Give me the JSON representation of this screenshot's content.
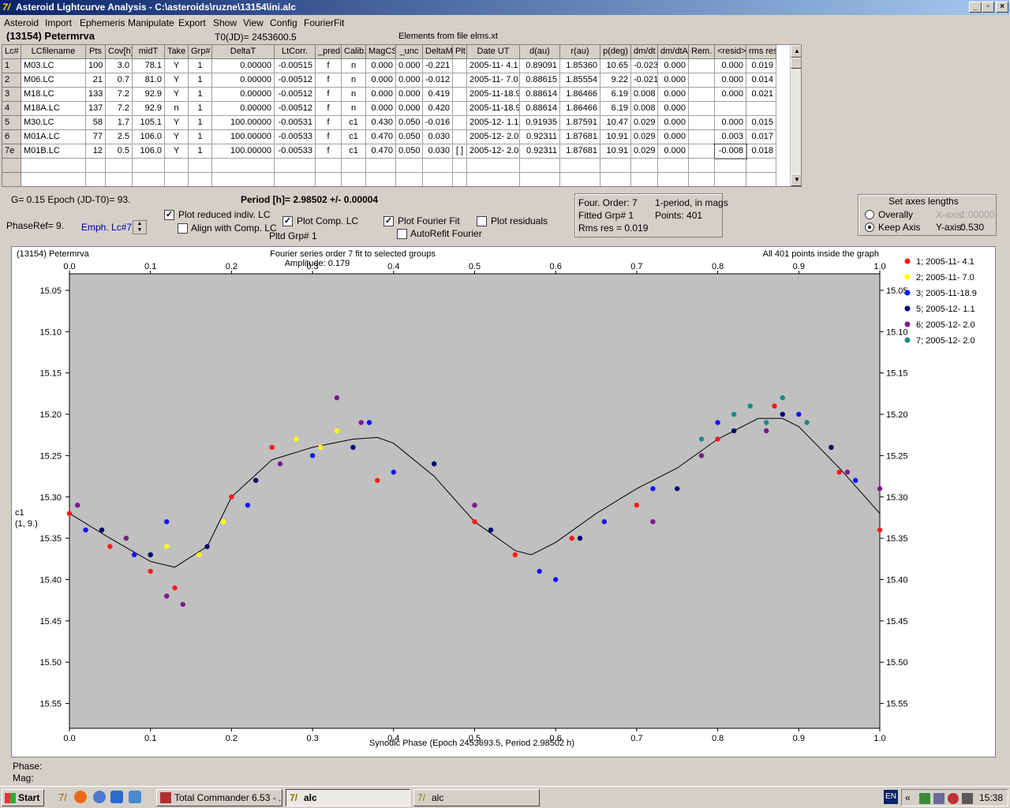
{
  "window": {
    "title": "Asteroid Lightcurve Analysis - C:\\asteroids\\ruzne\\13154\\ini.alc"
  },
  "menu": [
    "Asteroid",
    "Import",
    "Ephemeris",
    "Manipulate",
    "Export",
    "Show",
    "View",
    "Config",
    "FourierFit"
  ],
  "header": {
    "object": "(13154) Petermrva",
    "t0": "T0(JD)= 2453600.5",
    "elements": "Elements from file elms.xt"
  },
  "table": {
    "columns": [
      "Lc#",
      "LCfilename",
      "Pts",
      "Cov[h]",
      "midT",
      "Take",
      "Grp#",
      "DeltaT",
      "LtCorr.",
      "_pred.",
      "Calib.",
      "MagCS",
      "_unc",
      "DeltaM",
      "Plt",
      "Date UT",
      "d(au)",
      "r(au)",
      "p(deg)",
      "dm/dt",
      "dm/dtA",
      "Rem.",
      "<resid>",
      "rms res"
    ],
    "rows": [
      [
        "1",
        "M03.LC",
        "100",
        "3.0",
        "78.1",
        "Y",
        "1",
        "0.00000",
        "-0.00515",
        "f",
        "n",
        "0.000",
        "0.000",
        "-0.221",
        "",
        "2005-11- 4.1",
        "0.89091",
        "1.85360",
        "10.65",
        "-0.023",
        "0.000",
        "",
        "0.000",
        "0.019"
      ],
      [
        "2",
        "M06.LC",
        "21",
        "0.7",
        "81.0",
        "Y",
        "1",
        "0.00000",
        "-0.00512",
        "f",
        "n",
        "0.000",
        "0.000",
        "-0.012",
        "",
        "2005-11- 7.0",
        "0.88615",
        "1.85554",
        "9.22",
        "-0.021",
        "0.000",
        "",
        "0.000",
        "0.014"
      ],
      [
        "3",
        "M18.LC",
        "133",
        "7.2",
        "92.9",
        "Y",
        "1",
        "0.00000",
        "-0.00512",
        "f",
        "n",
        "0.000",
        "0.000",
        "0.419",
        "",
        "2005-11-18.9",
        "0.88614",
        "1.86466",
        "6.19",
        "0.008",
        "0.000",
        "",
        "0.000",
        "0.021"
      ],
      [
        "4",
        "M18A.LC",
        "137",
        "7.2",
        "92.9",
        "n",
        "1",
        "0.00000",
        "-0.00512",
        "f",
        "n",
        "0.000",
        "0.000",
        "0.420",
        "",
        "2005-11-18.9",
        "0.88614",
        "1.86466",
        "6.19",
        "0.008",
        "0.000",
        "",
        "",
        ""
      ],
      [
        "5",
        "M30.LC",
        "58",
        "1.7",
        "105.1",
        "Y",
        "1",
        "100.00000",
        "-0.00531",
        "f",
        "c1",
        "0.430",
        "0.050",
        "-0.016",
        "",
        "2005-12- 1.1",
        "0.91935",
        "1.87591",
        "10.47",
        "0.029",
        "0.000",
        "",
        "0.000",
        "0.015"
      ],
      [
        "6",
        "M01A.LC",
        "77",
        "2.5",
        "106.0",
        "Y",
        "1",
        "100.00000",
        "-0.00533",
        "f",
        "c1",
        "0.470",
        "0.050",
        "0.030",
        "",
        "2005-12- 2.0",
        "0.92311",
        "1.87681",
        "10.91",
        "0.029",
        "0.000",
        "",
        "0.003",
        "0.017"
      ],
      [
        "7e",
        "M01B.LC",
        "12",
        "0.5",
        "106.0",
        "Y",
        "1",
        "100.00000",
        "-0.00533",
        "f",
        "c1",
        "0.470",
        "0.050",
        "0.030",
        "[ ]",
        "2005-12- 2.0",
        "0.92311",
        "1.87681",
        "10.91",
        "0.029",
        "0.000",
        "",
        "-0.008",
        "0.018"
      ],
      [
        "",
        "",
        "",
        "",
        "",
        "",
        "",
        "",
        "",
        "",
        "",
        "",
        "",
        "",
        "",
        "",
        "",
        "",
        "",
        "",
        "",
        "",
        "",
        ""
      ],
      [
        "",
        "",
        "",
        "",
        "",
        "",
        "",
        "",
        "",
        "",
        "",
        "",
        "",
        "",
        "",
        "",
        "",
        "",
        "",
        "",
        "",
        "",
        "",
        ""
      ]
    ]
  },
  "controls": {
    "g_epoch": "G= 0.15    Epoch (JD-T0)= 93.",
    "period": "Period [h]= 2.98502 +/- 0.00004",
    "phaseref": "PhaseRef= 9.",
    "emph": "Emph. Lc#7:",
    "plot_reduced": "Plot reduced indiv. LC",
    "align_comp": "Align with Comp. LC",
    "plot_comp": "Plot Comp. LC",
    "pltd_grp": "Pltd Grp#  1",
    "plot_fourier": "Plot Fourier Fit",
    "autorefit": "AutoRefit Fourier",
    "plot_residuals": "Plot residuals",
    "fourier_info": {
      "order": "Four. Order:  7",
      "period_info": "1-period, in mags",
      "fitted": "Fitted Grp# 1",
      "points": "Points: 401",
      "rms": "Rms res      = 0.019"
    },
    "axes": {
      "title": "Set axes lengths",
      "overally": "Overally",
      "keep": "Keep Axis",
      "xaxis_label": "X-axis:",
      "xaxis_val": "1.00000",
      "yaxis_label": "Y-axis:",
      "yaxis_val": "0.530"
    }
  },
  "graph_text": {
    "object": "(13154) Petermrva",
    "fit": "Fourier series order 7 fit to selected groups",
    "amplitude": "Amplitude: 0.179",
    "inside": "All 401 points inside the graph",
    "ylabel1": "c1",
    "ylabel2": "(1, 9.)",
    "xlabel": "Synodic Phase (Epoch 2453693.5, Period 2.98502 h)"
  },
  "chart_data": {
    "type": "scatter",
    "xlim": [
      0,
      1
    ],
    "ylim": [
      15.03,
      15.58
    ],
    "y_reversed": true,
    "x_ticks": [
      "0.0",
      "0.1",
      "0.2",
      "0.3",
      "0.4",
      "0.5",
      "0.6",
      "0.7",
      "0.8",
      "0.9",
      "1.0"
    ],
    "y_ticks": [
      "15.05",
      "15.10",
      "15.15",
      "15.20",
      "15.25",
      "15.30",
      "15.35",
      "15.40",
      "15.45",
      "15.50",
      "15.55"
    ],
    "legend": [
      "1; 2005-11- 4.1",
      "2; 2005-11- 7.0",
      "3; 2005-11-18.9",
      "5; 2005-12- 1.1",
      "6; 2005-12- 2.0",
      "7; 2005-12- 2.0"
    ],
    "colors": [
      "#ff1818",
      "#ffff00",
      "#1414ff",
      "#000070",
      "#7a1a8c",
      "#1a8a8a"
    ],
    "fourier_fit": {
      "x": [
        0,
        0.05,
        0.1,
        0.13,
        0.17,
        0.2,
        0.25,
        0.3,
        0.35,
        0.38,
        0.4,
        0.45,
        0.5,
        0.55,
        0.57,
        0.6,
        0.65,
        0.7,
        0.75,
        0.8,
        0.85,
        0.88,
        0.9,
        0.95,
        1.0
      ],
      "y": [
        15.32,
        15.35,
        15.378,
        15.385,
        15.36,
        15.3,
        15.255,
        15.24,
        15.23,
        15.228,
        15.235,
        15.275,
        15.33,
        15.365,
        15.37,
        15.355,
        15.32,
        15.29,
        15.265,
        15.23,
        15.205,
        15.205,
        15.215,
        15.265,
        15.32
      ]
    },
    "series": [
      {
        "name": "1; 2005-11- 4.1",
        "points": [
          [
            0.0,
            15.32
          ],
          [
            0.05,
            15.36
          ],
          [
            0.1,
            15.39
          ],
          [
            0.13,
            15.41
          ],
          [
            0.2,
            15.3
          ],
          [
            0.25,
            15.24
          ],
          [
            0.38,
            15.28
          ],
          [
            0.5,
            15.33
          ],
          [
            0.55,
            15.37
          ],
          [
            0.62,
            15.35
          ],
          [
            0.7,
            15.31
          ],
          [
            0.8,
            15.23
          ],
          [
            0.87,
            15.19
          ],
          [
            0.95,
            15.27
          ],
          [
            1.0,
            15.34
          ]
        ]
      },
      {
        "name": "2; 2005-11- 7.0",
        "points": [
          [
            0.12,
            15.36
          ],
          [
            0.16,
            15.37
          ],
          [
            0.19,
            15.33
          ],
          [
            0.28,
            15.23
          ],
          [
            0.31,
            15.24
          ],
          [
            0.33,
            15.22
          ]
        ]
      },
      {
        "name": "3; 2005-11-18.9",
        "points": [
          [
            0.02,
            15.34
          ],
          [
            0.08,
            15.37
          ],
          [
            0.12,
            15.33
          ],
          [
            0.22,
            15.31
          ],
          [
            0.3,
            15.25
          ],
          [
            0.37,
            15.21
          ],
          [
            0.4,
            15.27
          ],
          [
            0.58,
            15.39
          ],
          [
            0.6,
            15.4
          ],
          [
            0.66,
            15.33
          ],
          [
            0.72,
            15.29
          ],
          [
            0.8,
            15.21
          ],
          [
            0.9,
            15.2
          ],
          [
            0.97,
            15.28
          ]
        ]
      },
      {
        "name": "5; 2005-12- 1.1",
        "points": [
          [
            0.04,
            15.34
          ],
          [
            0.1,
            15.37
          ],
          [
            0.17,
            15.36
          ],
          [
            0.23,
            15.28
          ],
          [
            0.35,
            15.24
          ],
          [
            0.45,
            15.26
          ],
          [
            0.52,
            15.34
          ],
          [
            0.63,
            15.35
          ],
          [
            0.75,
            15.29
          ],
          [
            0.82,
            15.22
          ],
          [
            0.88,
            15.2
          ],
          [
            0.94,
            15.24
          ]
        ]
      },
      {
        "name": "6; 2005-12- 2.0",
        "points": [
          [
            0.01,
            15.31
          ],
          [
            0.07,
            15.35
          ],
          [
            0.12,
            15.42
          ],
          [
            0.14,
            15.43
          ],
          [
            0.26,
            15.26
          ],
          [
            0.33,
            15.18
          ],
          [
            0.36,
            15.21
          ],
          [
            0.5,
            15.31
          ],
          [
            0.72,
            15.33
          ],
          [
            0.78,
            15.25
          ],
          [
            0.86,
            15.22
          ],
          [
            0.96,
            15.27
          ],
          [
            1.0,
            15.29
          ]
        ]
      },
      {
        "name": "7; 2005-12- 2.0",
        "points": [
          [
            0.78,
            15.23
          ],
          [
            0.82,
            15.2
          ],
          [
            0.84,
            15.19
          ],
          [
            0.86,
            15.21
          ],
          [
            0.88,
            15.18
          ],
          [
            0.91,
            15.21
          ]
        ]
      }
    ]
  },
  "status": {
    "phase": "Phase:",
    "mag": "Mag:"
  },
  "taskbar": {
    "start": "Start",
    "items": [
      "Total Commander 6.53 - ...",
      "alc",
      "alc"
    ],
    "lang": "EN",
    "clock": "15:38"
  }
}
